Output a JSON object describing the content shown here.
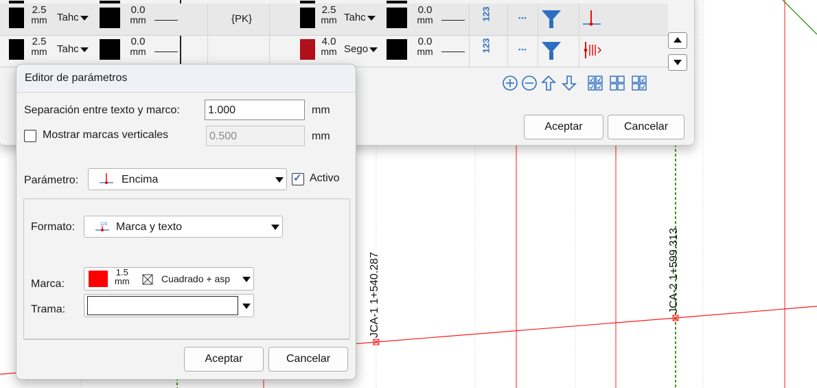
{
  "colors": {
    "red_line": "#ff1a1a",
    "green_dash": "#3a9a1a",
    "accent": "#2d6fbf",
    "dark_red": "#b0101a"
  },
  "table": {
    "row1": {
      "thick_a": "2.5",
      "unit": "mm",
      "font_a": "Tahc",
      "thick_b": "0.0",
      "pk": "{PK}",
      "thick_c": "2.5",
      "font_c": "Tahc",
      "thick_d": "0.0"
    },
    "row2": {
      "thick_a": "2.5",
      "unit": "mm",
      "font_a": "Tahc",
      "thick_b": "0.0",
      "thick_c": "4.0",
      "font_c": "Sego",
      "thick_d": "0.0"
    },
    "icon_123": "123",
    "toolbar_icons": [
      "add-circle-icon",
      "remove-circle-icon",
      "move-up-icon",
      "move-down-icon",
      "check-all-icon",
      "uncheck-all-icon",
      "invert-check-icon"
    ],
    "accept": "Aceptar",
    "cancel": "Cancelar"
  },
  "editor": {
    "title": "Editor de parámetros",
    "separation_label": "Separación entre texto y marco:",
    "separation_value": "1.000",
    "unit": "mm",
    "show_marks_label": "Mostrar marcas verticales",
    "show_marks_value": "0.500",
    "show_marks_checked": false,
    "param_label": "Parámetro:",
    "param_value": "Encima",
    "active_label": "Activo",
    "active_checked": true,
    "format_label": "Formato:",
    "format_value": "Marca y texto",
    "mark_label": "Marca:",
    "mark_size": "1.5",
    "mark_unit": "mm",
    "mark_style": "Cuadrado + asp",
    "mark_color": "#ff0000",
    "hatch_label": "Trama:",
    "accept": "Aceptar",
    "cancel": "Cancelar"
  },
  "drawing": {
    "label1": "JCA-1 1+540.287",
    "label2": "JCA-2 1+599.313"
  }
}
